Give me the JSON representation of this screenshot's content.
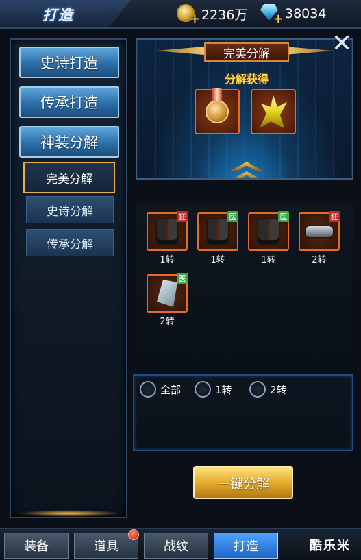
{
  "header": {
    "title": "打造",
    "gold": {
      "icon": "gold-coin-icon",
      "value": "2236万"
    },
    "diamond": {
      "icon": "diamond-icon",
      "value": "38034"
    }
  },
  "sidebar": {
    "main_items": [
      {
        "label": "史诗打造"
      },
      {
        "label": "传承打造"
      },
      {
        "label": "神装分解"
      }
    ],
    "sub_items": [
      {
        "label": "完美分解",
        "active": true
      },
      {
        "label": "史诗分解",
        "active": false
      },
      {
        "label": "传承分解",
        "active": false
      }
    ]
  },
  "panel": {
    "title": "完美分解",
    "gain_label": "分解获得",
    "rewards": [
      {
        "icon": "medal-icon"
      },
      {
        "icon": "yellow-crystal-icon"
      }
    ],
    "items": [
      {
        "icon": "boots-icon",
        "tag": "狂",
        "tag_color": "#c12a2a",
        "label": "1转"
      },
      {
        "icon": "boots-icon",
        "tag": "医",
        "tag_color": "#3aa84a",
        "label": "1转"
      },
      {
        "icon": "boots-icon",
        "tag": "医",
        "tag_color": "#3aa84a",
        "label": "1转"
      },
      {
        "icon": "belt-icon",
        "tag": "狂",
        "tag_color": "#c12a2a",
        "label": "2转"
      },
      {
        "icon": "gauntlet-icon",
        "tag": "医",
        "tag_color": "#3aa84a",
        "label": "2转"
      }
    ],
    "filters": [
      {
        "label": "全部"
      },
      {
        "label": "1转"
      },
      {
        "label": "2转"
      }
    ],
    "decompose_button": "一键分解"
  },
  "bottom_tabs": [
    {
      "label": "装备",
      "active": false
    },
    {
      "label": "道具",
      "active": false,
      "notification": true
    },
    {
      "label": "战纹",
      "active": false
    },
    {
      "label": "打造",
      "active": true
    }
  ],
  "watermark": "酷乐米"
}
